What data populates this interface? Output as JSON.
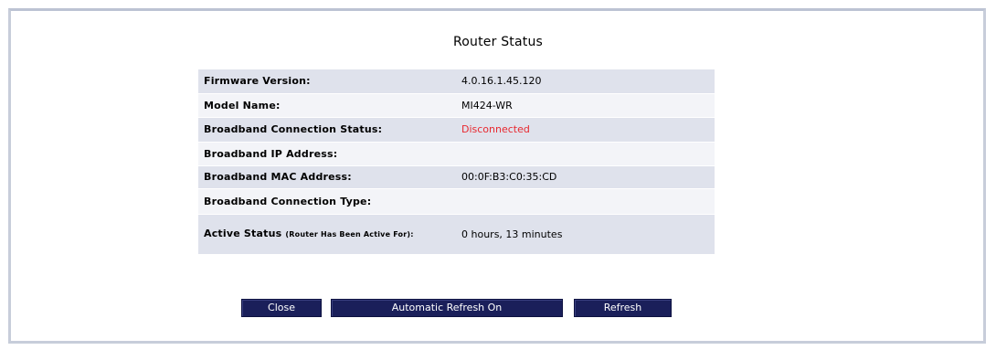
{
  "title": "Router Status",
  "rows": [
    {
      "label": "Firmware Version:",
      "value": "4.0.16.1.45.120"
    },
    {
      "label": "Model Name:",
      "value": "MI424-WR"
    },
    {
      "label": "Broadband Connection Status:",
      "value": "Disconnected"
    },
    {
      "label": "Broadband IP Address:",
      "value": ""
    },
    {
      "label": "Broadband MAC Address:",
      "value": "00:0F:B3:C0:35:CD"
    },
    {
      "label": "Broadband Connection Type:",
      "value": ""
    },
    {
      "label": "Active Status",
      "label_suffix": "(Router Has Been Active For):",
      "value": "0 hours, 13 minutes"
    }
  ],
  "buttons": {
    "close": "Close",
    "auto_refresh": "Automatic Refresh On",
    "refresh": "Refresh"
  },
  "colors": {
    "button_bg": "#1a1f5a",
    "row_shade": "#dfe2ec",
    "row_light": "#f3f4f8",
    "status_disconnected": "#e8282f"
  }
}
